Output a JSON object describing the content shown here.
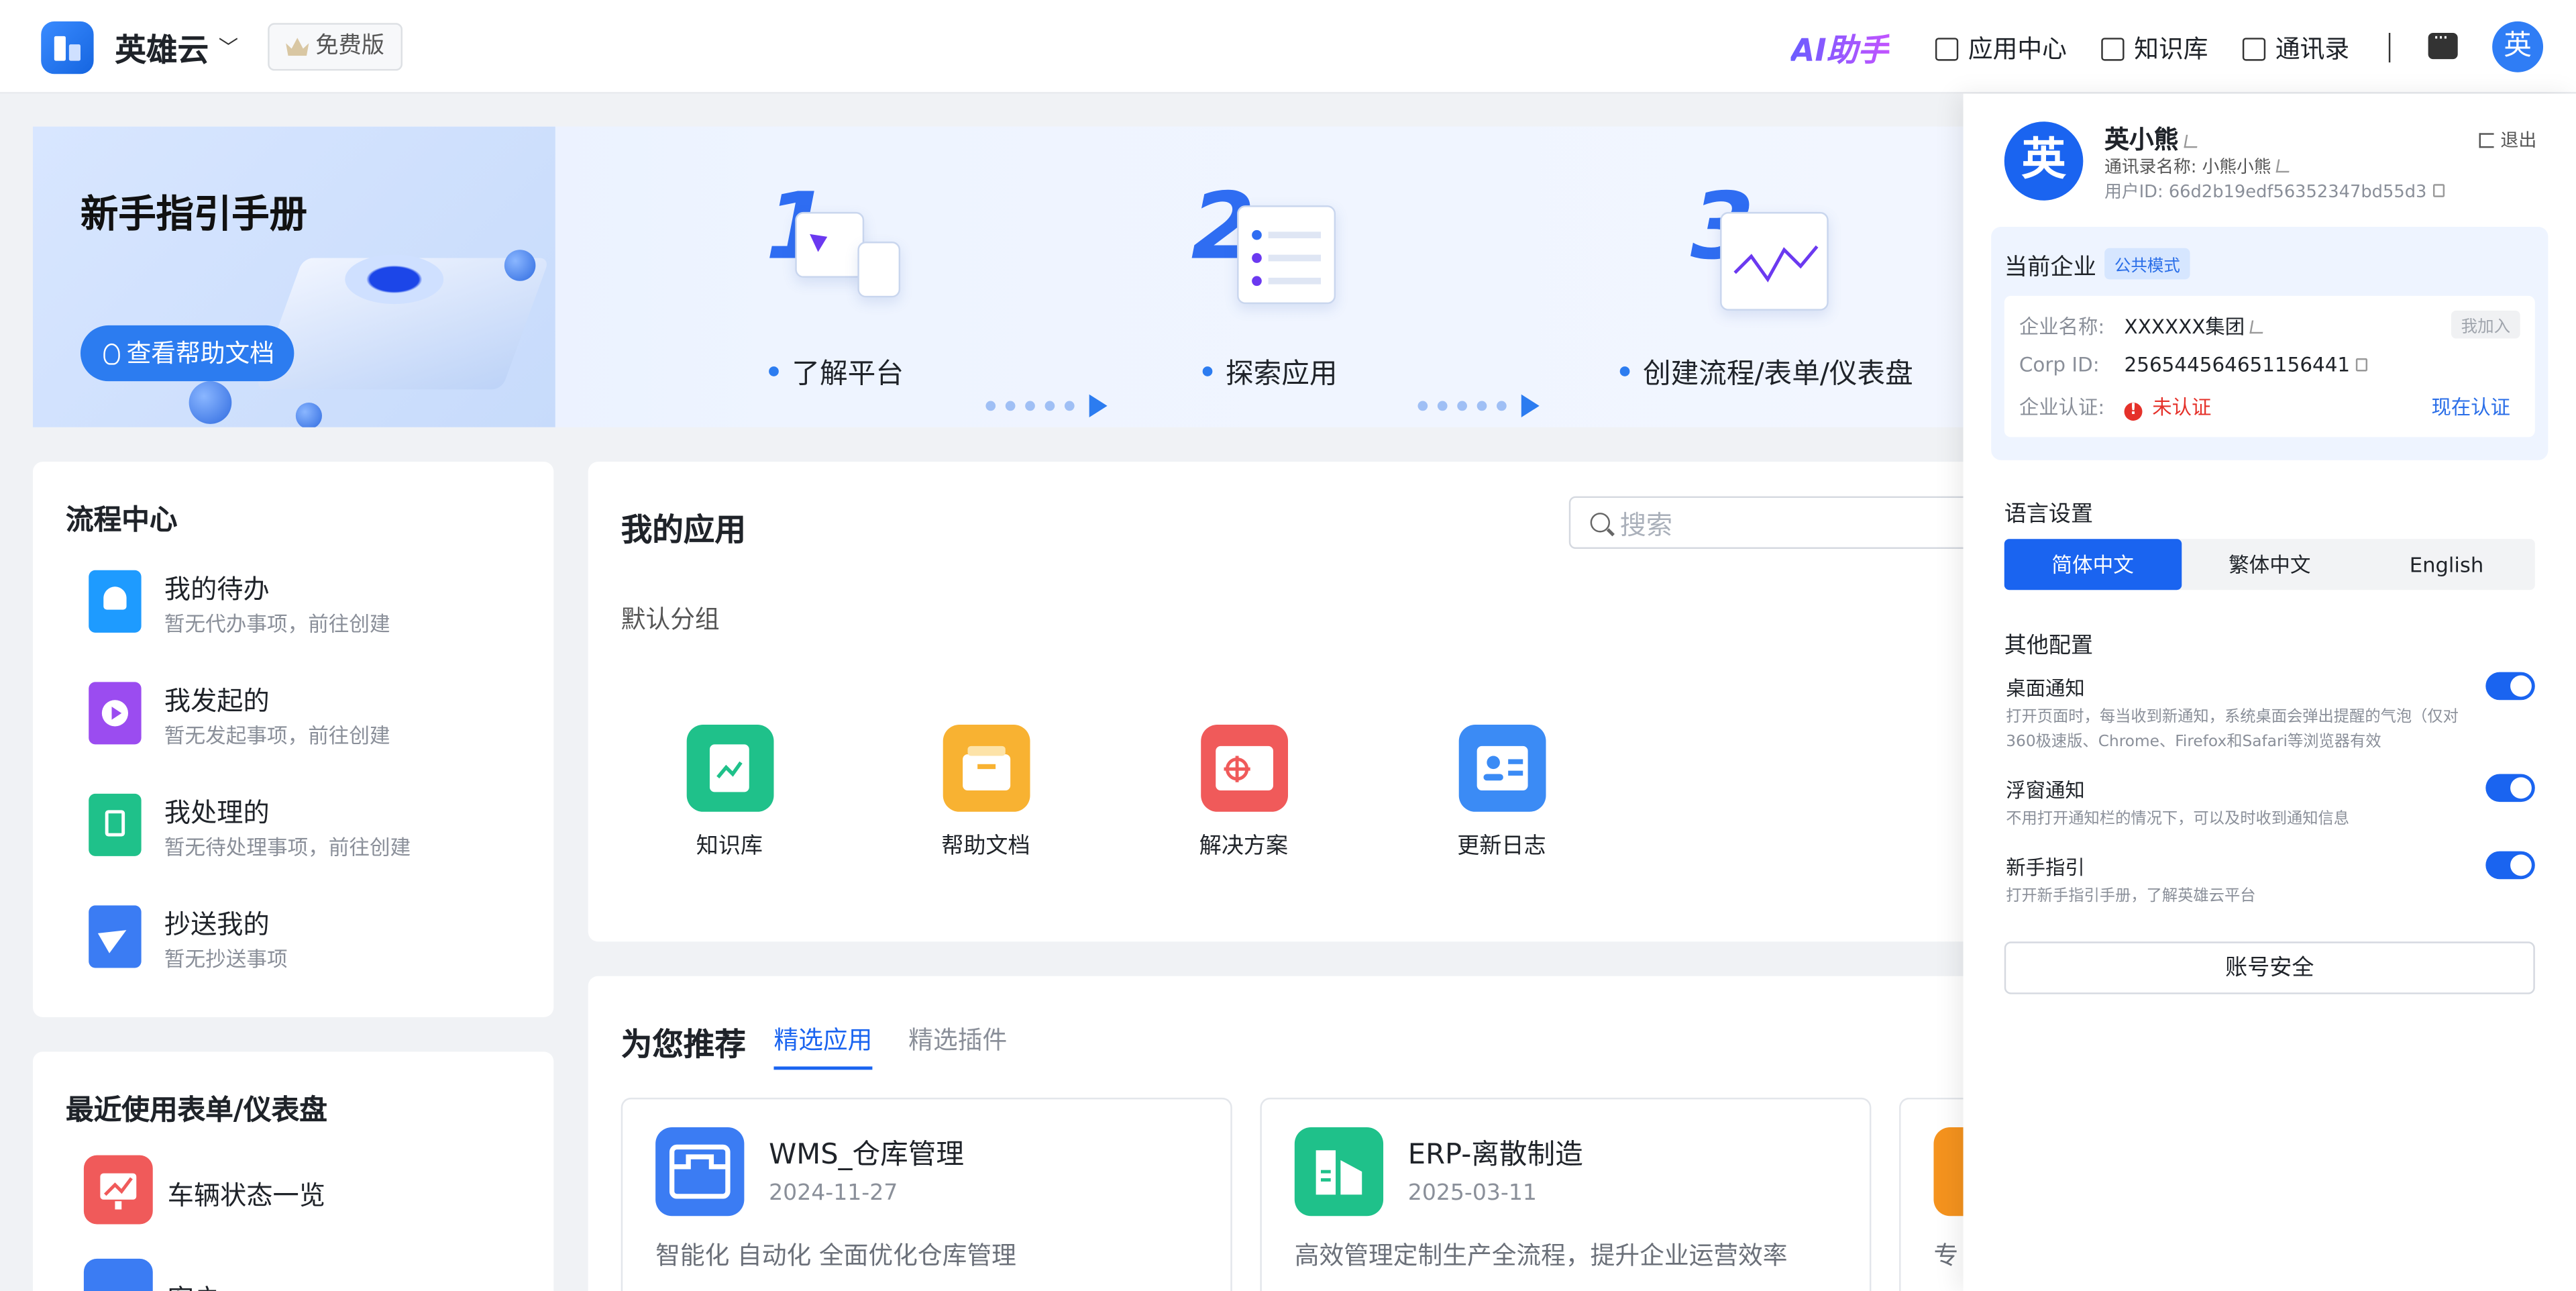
{
  "header": {
    "brand": "英雄云",
    "plan_badge": "免费版",
    "ai_label": "AI助手",
    "nav": [
      {
        "label": "应用中心",
        "icon": "app-center-icon"
      },
      {
        "label": "知识库",
        "icon": "book-icon"
      },
      {
        "label": "通讯录",
        "icon": "contacts-icon"
      }
    ],
    "avatar_text": "英"
  },
  "banner": {
    "title": "新手指引手册",
    "help_button": "查看帮助文档",
    "steps": [
      {
        "label": "了解平台"
      },
      {
        "label": "探索应用"
      },
      {
        "label": "创建流程/表单/仪表盘"
      }
    ]
  },
  "flow_center": {
    "title": "流程中心",
    "items": [
      {
        "name": "我的待办",
        "sub": "暂无代办事项，前往创建",
        "color": "#1e9bff",
        "icon": "bell-icon"
      },
      {
        "name": "我发起的",
        "sub": "暂无发起事项，前往创建",
        "color": "#9b4cf0",
        "icon": "play-icon"
      },
      {
        "name": "我处理的",
        "sub": "暂无待处理事项，前往创建",
        "color": "#1fc18a",
        "icon": "hourglass-icon"
      },
      {
        "name": "抄送我的",
        "sub": "暂无抄送事项",
        "color": "#3b7cf3",
        "icon": "send-icon"
      }
    ]
  },
  "recent": {
    "title": "最近使用表单/仪表盘",
    "items": [
      {
        "name": "车辆状态一览",
        "color": "#f05a5a",
        "icon": "chart-icon"
      },
      {
        "name": "客户",
        "color": "#3b7cf3",
        "icon": "form-icon"
      }
    ]
  },
  "my_apps": {
    "title": "我的应用",
    "search_placeholder": "搜索",
    "group": "默认分组",
    "apps": [
      {
        "name": "知识库",
        "color": "#1fc18a",
        "icon": "knowledge-icon"
      },
      {
        "name": "帮助文档",
        "color": "#f8b232",
        "icon": "box-icon"
      },
      {
        "name": "解决方案",
        "color": "#f05a5a",
        "icon": "target-icon"
      },
      {
        "name": "更新日志",
        "color": "#3b8bf5",
        "icon": "id-card-icon"
      }
    ]
  },
  "recommend": {
    "title": "为您推荐",
    "tabs": [
      "精选应用",
      "精选插件"
    ],
    "cards": [
      {
        "name": "WMS_仓库管理",
        "date": "2024-11-27",
        "desc": "智能化 自动化 全面优化仓库管理",
        "color": "#3b7cf3",
        "icon": "warehouse-icon"
      },
      {
        "name": "ERP-离散制造",
        "date": "2025-03-11",
        "desc": "高效管理定制生产全流程，提升企业运营效率",
        "color": "#1fc18a",
        "icon": "factory-icon"
      },
      {
        "name": "",
        "date": "",
        "desc": "专",
        "color": "#f5931e",
        "icon": "person-icon"
      }
    ]
  },
  "profile": {
    "avatar_text": "英",
    "name": "英小熊",
    "contact_name": "通讯录名称: 小熊小熊",
    "user_id": "用户ID: 66d2b19edf56352347bd55d3",
    "logout": "退出",
    "enterprise": {
      "heading": "当前企业",
      "mode_tag": "公共模式",
      "name_label": "企业名称:",
      "name_value": "XXXXXX集团",
      "join": "我加入",
      "corp_label": "Corp ID:",
      "corp_value": "256544564651156441",
      "cert_label": "企业认证:",
      "cert_value": "未认证",
      "cert_action": "现在认证"
    },
    "language": {
      "heading": "语言设置",
      "options": [
        "简体中文",
        "繁体中文",
        "English"
      ],
      "selected": "简体中文"
    },
    "other": {
      "heading": "其他配置",
      "items": [
        {
          "name": "桌面通知",
          "desc": "打开页面时，每当收到新通知，系统桌面会弹出提醒的气泡（仅对360极速版、Chrome、Firefox和Safari等浏览器有效",
          "on": true
        },
        {
          "name": "浮窗通知",
          "desc": "不用打开通知栏的情况下，可以及时收到通知信息",
          "on": true
        },
        {
          "name": "新手指引",
          "desc": "打开新手指引手册，了解英雄云平台",
          "on": true
        }
      ]
    },
    "account_security": "账号安全"
  }
}
